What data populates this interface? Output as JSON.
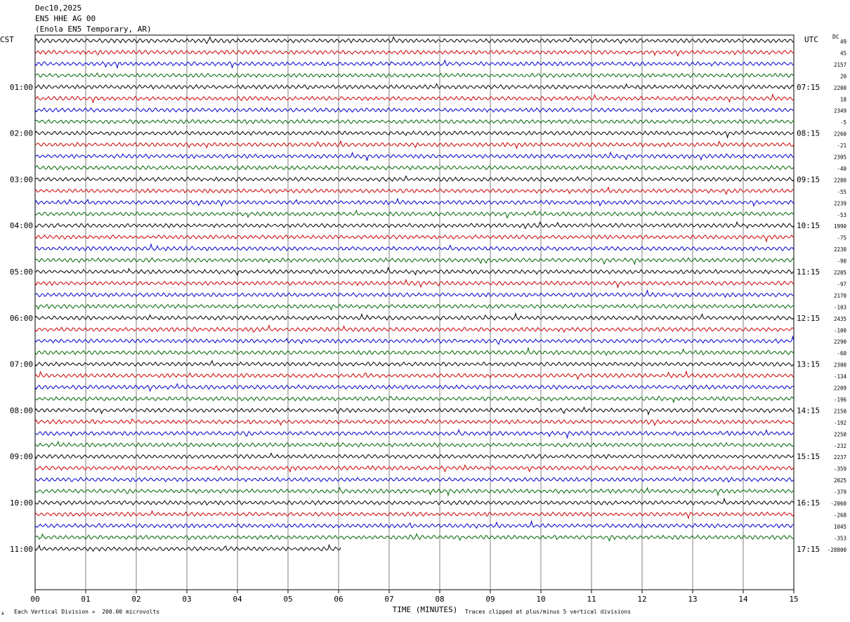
{
  "header": {
    "date": "Dec10,2025",
    "station": "EN5 HHE AG 00",
    "location": "(Enola EN5 Temporary, AR)"
  },
  "left_tz": "CST",
  "right_tz": "UTC",
  "dc_label": "DC",
  "footer": {
    "scale_note": "Each Vertical Division =  200.00 microvolts",
    "clip_note": "Traces clipped at plus/minus 5 vertical divisions",
    "corner_mark": "A"
  },
  "colors": {
    "trace_cycle": [
      "#000000",
      "#cc0000",
      "#0000cc",
      "#006600"
    ],
    "grid": "#808080"
  },
  "chart_data": {
    "type": "line",
    "xlabel": "TIME (MINUTES)",
    "xlim": [
      0,
      15
    ],
    "x_ticks": [
      "00",
      "01",
      "02",
      "03",
      "04",
      "05",
      "06",
      "07",
      "08",
      "09",
      "10",
      "11",
      "12",
      "13",
      "14",
      "15"
    ],
    "minutes_per_row": 15,
    "rows_per_hour": 4,
    "hour_labels_left": [
      "01:00",
      "02:00",
      "03:00",
      "04:00",
      "05:00",
      "06:00",
      "07:00",
      "08:00",
      "09:00",
      "10:00",
      "11:00"
    ],
    "hour_labels_right": [
      "07:15",
      "08:15",
      "09:15",
      "10:15",
      "11:15",
      "12:15",
      "13:15",
      "14:15",
      "15:15",
      "16:15",
      "17:15"
    ],
    "dc_offsets": [
      "49",
      "45",
      "2157",
      "20",
      "2200",
      "18",
      "2349",
      "-5",
      "2260",
      "-21",
      "2305",
      "-40",
      "2280",
      "-55",
      "2239",
      "-53",
      "1990",
      "-75",
      "2230",
      "-90",
      "2205",
      "-97",
      "2170",
      "-103",
      "2435",
      "-100",
      "2290",
      "-60",
      "2300",
      "-134",
      "2209",
      "-196",
      "2150",
      "-192",
      "2250",
      "-232",
      "2237",
      "-359",
      "2025",
      "-379",
      "-2060",
      "-268",
      "1045",
      "-353",
      "-28800"
    ],
    "last_row_end_minute": 6.05,
    "trace_amplitude_px": 3,
    "row_count": 45
  }
}
